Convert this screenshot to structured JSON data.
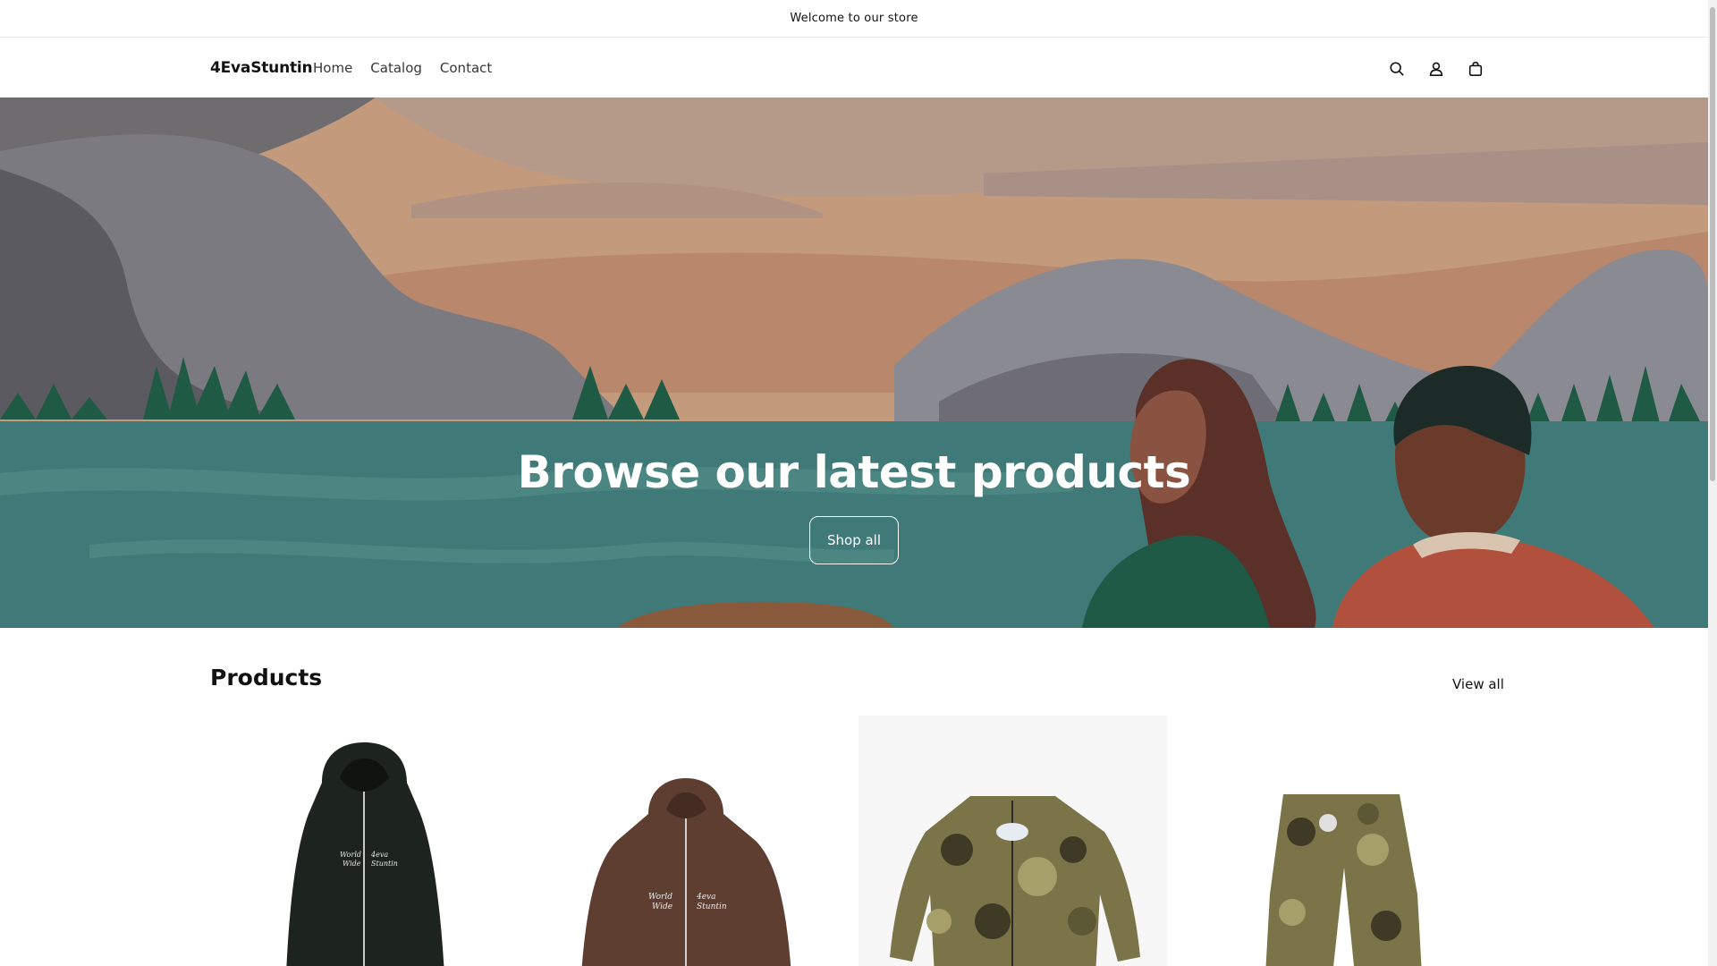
{
  "announcement": {
    "text": "Welcome to our store"
  },
  "header": {
    "logo": "4EvaStuntin",
    "nav": [
      {
        "label": "Home"
      },
      {
        "label": "Catalog"
      },
      {
        "label": "Contact"
      }
    ],
    "icons": [
      "search-icon",
      "account-icon",
      "cart-icon"
    ]
  },
  "hero": {
    "title": "Browse our latest products",
    "button_label": "Shop all"
  },
  "products": {
    "title": "Products",
    "view_all_label": "View all",
    "items": [
      {
        "image": "black-zip-hoodie"
      },
      {
        "image": "brown-zip-hoodie"
      },
      {
        "image": "camo-track-jacket"
      },
      {
        "image": "camo-pants"
      }
    ]
  },
  "colors": {
    "text": "#121212",
    "hero_water": "#3f7a78",
    "hero_sky": "#c49a7d",
    "border": "#e6e6e6"
  }
}
